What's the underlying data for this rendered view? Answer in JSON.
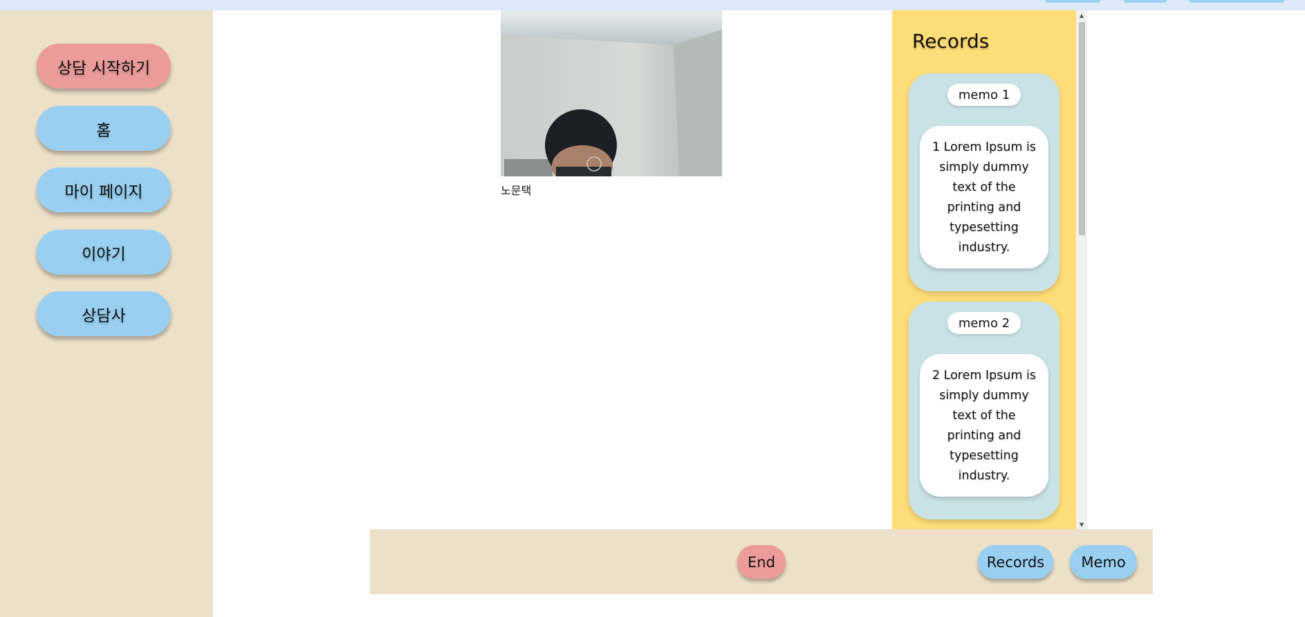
{
  "sidebar": {
    "items": [
      {
        "label": "상담 시작하기"
      },
      {
        "label": "홈"
      },
      {
        "label": "마이 페이지"
      },
      {
        "label": "이야기"
      },
      {
        "label": "상담사"
      }
    ]
  },
  "video": {
    "participant_name": "노문택"
  },
  "records": {
    "title": "Records",
    "memos": [
      {
        "label": "memo 1",
        "text": "1 Lorem Ipsum is simply dummy text of the printing and typesetting industry."
      },
      {
        "label": "memo 2",
        "text": "2 Lorem Ipsum is simply dummy text of the printing and typesetting industry."
      }
    ]
  },
  "controls": {
    "end_label": "End",
    "records_label": "Records",
    "memo_label": "Memo"
  },
  "colors": {
    "sidebar_bg": "#ece0c8",
    "primary_button": "#ec9b9b",
    "secondary_button": "#99d0f2",
    "records_panel_bg": "#ffdd78",
    "memo_card_bg": "#c9e2e6"
  }
}
